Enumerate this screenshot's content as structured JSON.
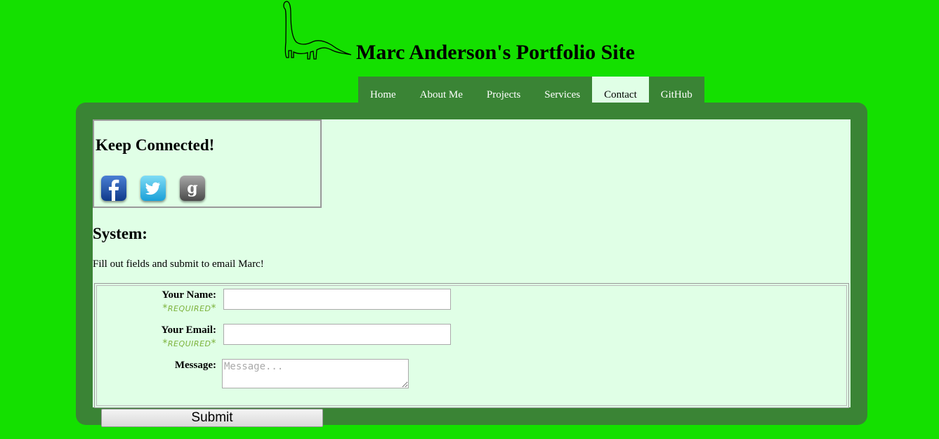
{
  "header": {
    "title": "Marc Anderson's Portfolio Site",
    "logo": "dinosaur-logo"
  },
  "nav": {
    "items": [
      {
        "label": "Home",
        "active": false
      },
      {
        "label": "About Me",
        "active": false
      },
      {
        "label": "Projects",
        "active": false
      },
      {
        "label": "Services",
        "active": false
      },
      {
        "label": "Contact",
        "active": true
      },
      {
        "label": "GitHub",
        "active": false
      }
    ]
  },
  "connect": {
    "title": "Keep Connected!",
    "icons": [
      "facebook-icon",
      "twitter-icon",
      "google-icon"
    ]
  },
  "main": {
    "section_title": "System:",
    "intro": "Fill out fields and submit to email Marc!"
  },
  "form": {
    "name_label": "Your Name:",
    "name_required": "REQUIRED",
    "name_value": "",
    "email_label": "Your Email:",
    "email_required": "REQUIRED",
    "email_value": "",
    "message_label": "Message:",
    "message_placeholder": "Message...",
    "submit_label": "Submit"
  },
  "colors": {
    "page_background": "#14e000",
    "container": "#3a8435",
    "content_background": "#e0ffe6",
    "required_text": "#7bb23a"
  }
}
